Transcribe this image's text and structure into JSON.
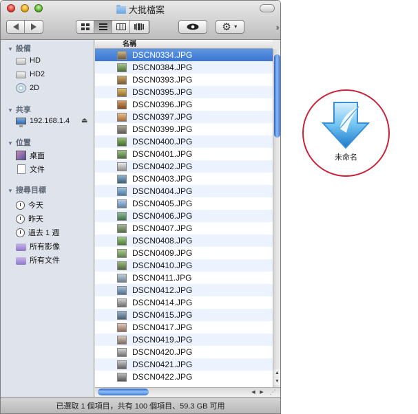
{
  "window": {
    "title": "大批檔案",
    "view_modes": [
      "icon-view-icon",
      "list-view-icon",
      "column-view-icon",
      "coverflow-view-icon"
    ]
  },
  "sidebar": {
    "sections": [
      {
        "label": "設備",
        "items": [
          {
            "label": "HD",
            "icon": "hard-disk-icon"
          },
          {
            "label": "HD2",
            "icon": "hard-disk-icon"
          },
          {
            "label": "2D",
            "icon": "disc-icon"
          }
        ]
      },
      {
        "label": "共享",
        "items": [
          {
            "label": "192.168.1.4",
            "icon": "network-computer-icon"
          }
        ]
      },
      {
        "label": "位置",
        "items": [
          {
            "label": "桌面",
            "icon": "desktop-icon"
          },
          {
            "label": "文件",
            "icon": "document-icon"
          }
        ]
      },
      {
        "label": "搜尋目標",
        "items": [
          {
            "label": "今天",
            "icon": "clock-icon"
          },
          {
            "label": "昨天",
            "icon": "clock-icon"
          },
          {
            "label": "過去 1 週",
            "icon": "clock-icon"
          },
          {
            "label": "所有影像",
            "icon": "smart-folder-icon"
          },
          {
            "label": "所有文件",
            "icon": "smart-folder-icon"
          }
        ]
      }
    ]
  },
  "list": {
    "column_header": "名稱",
    "files": [
      "DSCN0334.JPG",
      "DSCN0384.JPG",
      "DSCN0393.JPG",
      "DSCN0395.JPG",
      "DSCN0396.JPG",
      "DSCN0397.JPG",
      "DSCN0399.JPG",
      "DSCN0400.JPG",
      "DSCN0401.JPG",
      "DSCN0402.JPG",
      "DSCN0403.JPG",
      "DSCN0404.JPG",
      "DSCN0405.JPG",
      "DSCN0406.JPG",
      "DSCN0407.JPG",
      "DSCN0408.JPG",
      "DSCN0409.JPG",
      "DSCN0410.JPG",
      "DSCN0411.JPG",
      "DSCN0412.JPG",
      "DSCN0414.JPG",
      "DSCN0415.JPG",
      "DSCN0417.JPG",
      "DSCN0419.JPG",
      "DSCN0420.JPG",
      "DSCN0421.JPG",
      "DSCN0422.JPG"
    ],
    "selected_index": 0
  },
  "status_bar": {
    "text": "已選取 1 個項目，共有 100 個項目、59.3 GB 可用"
  },
  "annotation": {
    "app_label": "未命名"
  },
  "colors": {
    "selection": "#3c75d0",
    "circle": "#c9233a",
    "sidebar_bg": "#dfe4ec"
  }
}
